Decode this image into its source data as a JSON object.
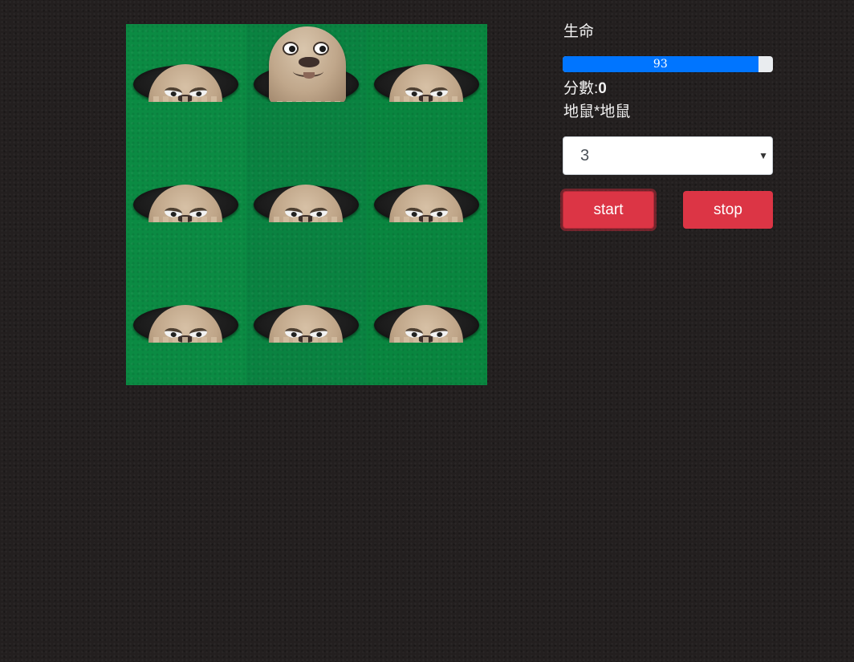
{
  "game": {
    "grid_rows": 3,
    "grid_cols": 3,
    "active_hole": 1,
    "holes": [
      {
        "state": "peeking"
      },
      {
        "state": "up"
      },
      {
        "state": "peeking"
      },
      {
        "state": "peeking"
      },
      {
        "state": "peeking"
      },
      {
        "state": "peeking"
      },
      {
        "state": "peeking"
      },
      {
        "state": "peeking"
      },
      {
        "state": "peeking"
      }
    ]
  },
  "panel": {
    "life_label": "生命",
    "life_value": 93,
    "life_max": 100,
    "life_text": "93",
    "score_label": "分數:",
    "score_value": "0",
    "mode_label": "地鼠*地鼠",
    "level_selected": "3",
    "start_label": "start",
    "stop_label": "stop"
  },
  "colors": {
    "grass": "#0a8a41",
    "background": "#231f1f",
    "progress": "#0075ff",
    "button": "#dc3545",
    "mole_fur": "#c0a78b"
  }
}
